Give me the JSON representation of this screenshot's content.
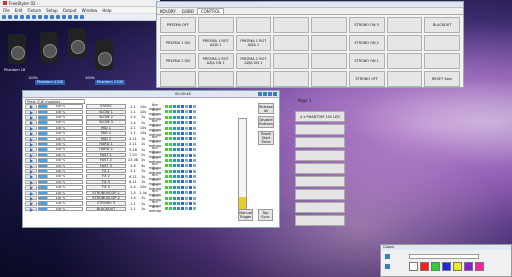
{
  "app": {
    "title": "FreeStyler 02 -"
  },
  "menu": [
    "File",
    "Edit",
    "Fixture",
    "Setup",
    "Output",
    "Window",
    "Help"
  ],
  "fixtures": {
    "label1": "Phantom 18",
    "label2": "Phantom 4 DIS",
    "label3": "Phantom 3 DIS",
    "pct1": "100%",
    "pct2": "100%"
  },
  "control": {
    "tabs": [
      "KOLORY",
      "GOBO",
      "CONTROL"
    ],
    "buttons": [
      "PRYZMA OFF",
      "",
      "",
      "",
      "",
      "STROBO ON 3",
      "",
      "BLACKOUT",
      "PRYZMA 1 ON",
      "PRYZMA 1 ROT AZJA 1",
      "PRYZMA 1 ROT AZJA 1",
      "",
      "",
      "STROBO ON 2",
      "",
      "",
      "PRYZMA 2 ON",
      "PRYZMA 2 ROT AZJA ON 1",
      "PRYZMA 2 ROT AZJA ON 1",
      "",
      "",
      "STROBO ON 1",
      "",
      "",
      "",
      "",
      "",
      "",
      "",
      "STROBO OFF",
      "",
      "RESET 5sec"
    ]
  },
  "main": {
    "time": "00:00:46",
    "select": "Prest CUE modules",
    "rows": [
      {
        "pct": "100 %",
        "name": "STATIC",
        "v1": "1.1",
        "v2": "10s",
        "v3": "6m metrop"
      },
      {
        "pct": "100 %",
        "name": "SLOW 1",
        "v1": "1.1",
        "v2": "10s",
        "v3": "6m metrop"
      },
      {
        "pct": "100 %",
        "name": "SLOW 2",
        "v1": "2.4",
        "v2": "1s",
        "v3": "6m metrop"
      },
      {
        "pct": "100 %",
        "name": "SLOW 3",
        "v1": "1.4",
        "v2": "1s",
        "v3": "6m metrop"
      },
      {
        "pct": "100 %",
        "name": "MID 1",
        "v1": "2.1",
        "v2": "10s",
        "v3": "6m metrop"
      },
      {
        "pct": "100 %",
        "name": "MID 2",
        "v1": "1.1",
        "v2": "10s",
        "v3": "6m metrop"
      },
      {
        "pct": "100 %",
        "name": "MID 3",
        "v1": "4.11",
        "v2": "1s",
        "v3": "6m metrop"
      },
      {
        "pct": "100 %",
        "name": "HARD 1",
        "v1": "2.11",
        "v2": "1s",
        "v3": "6m metrop"
      },
      {
        "pct": "100 %",
        "name": "HARD 2",
        "v1": "5.16",
        "v2": "1s",
        "v3": "6m metrop"
      },
      {
        "pct": "100 %",
        "name": "FAST 1",
        "v1": "7.20",
        "v2": "2s",
        "v3": "6m metrop"
      },
      {
        "pct": "100 %",
        "name": "FAST 2",
        "v1": "23.38",
        "v2": "1s",
        "v3": "6m metrop"
      },
      {
        "pct": "100 %",
        "name": "FAST 3",
        "v1": "1.6",
        "v2": "4s",
        "v3": "6m metrop"
      },
      {
        "pct": "100 %",
        "name": "FX 1",
        "v1": "1.1",
        "v2": "1s",
        "v3": "6m metrop"
      },
      {
        "pct": "100 %",
        "name": "FX 2",
        "v1": "6.11",
        "v2": "1s",
        "v3": "6m metrop"
      },
      {
        "pct": "100 %",
        "name": "FX 3",
        "v1": "8.11",
        "v2": "1s",
        "v3": "6m metrop"
      },
      {
        "pct": "100 %",
        "name": "FX 4",
        "v1": "2.4",
        "v2": "10s",
        "v3": "6m metrop"
      },
      {
        "pct": "100 %",
        "name": "STROBOSCOP 1",
        "v1": "1.4",
        "v2": "1.4s",
        "v3": "6m metrop"
      },
      {
        "pct": "100 %",
        "name": "STROBOSCOP 2",
        "v1": "1.4",
        "v2": "1s",
        "v3": "6m metrop"
      },
      {
        "pct": "100 %",
        "name": "STROBO 3",
        "v1": "1.1",
        "v2": "1s",
        "v3": "6m metrop"
      },
      {
        "pct": "100 %",
        "name": "BLACKOUT",
        "v1": "1.1",
        "v2": "1s",
        "v3": "6m metrop"
      }
    ],
    "side": {
      "release": "Release All",
      "disable": "Disable Buttons",
      "reset": "Reset Start Timer",
      "manual": "Manual Trigger",
      "tap": "Tap Sync"
    },
    "meter_level": 0.2
  },
  "page": {
    "label": "Page 1",
    "first": "4 x PHANTOM 150 LED"
  },
  "colors": {
    "title": "Colors",
    "swatches": [
      "#ffffff",
      "#ff1e1e",
      "#2ad12a",
      "#1e2ae0",
      "#f0e81e",
      "#8a1ecf",
      "#ff1ea0"
    ]
  }
}
